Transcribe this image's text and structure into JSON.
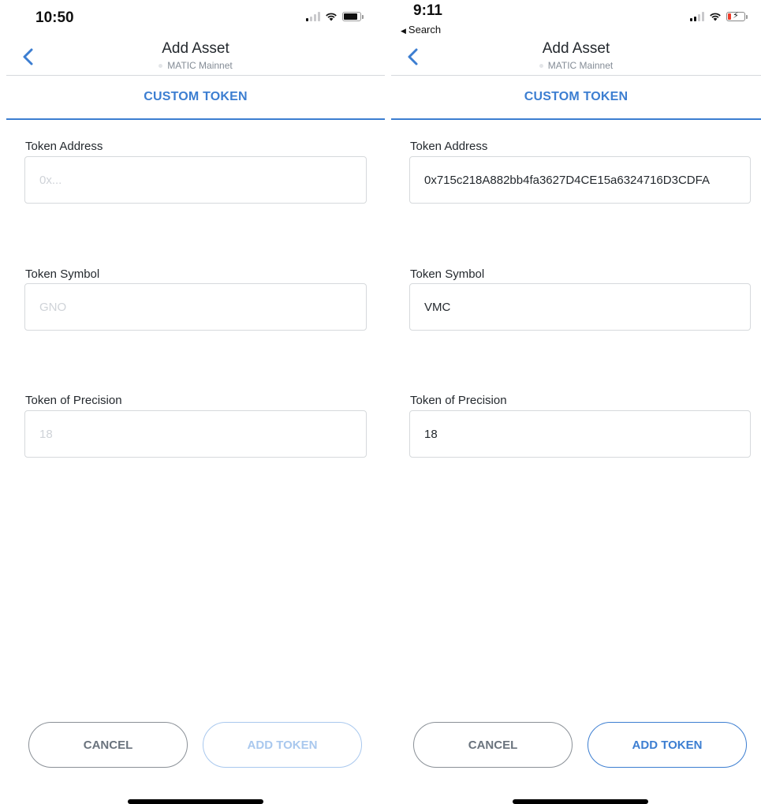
{
  "left": {
    "status": {
      "time": "10:50"
    },
    "header": {
      "title": "Add Asset",
      "network": "MATIC Mainnet"
    },
    "tab_label": "CUSTOM TOKEN",
    "fields": {
      "address": {
        "label": "Token Address",
        "value": "",
        "placeholder": "0x..."
      },
      "symbol": {
        "label": "Token Symbol",
        "value": "",
        "placeholder": "GNO"
      },
      "precision": {
        "label": "Token of Precision",
        "value": "",
        "placeholder": "18"
      }
    },
    "buttons": {
      "cancel": "CANCEL",
      "add": "ADD TOKEN",
      "add_enabled": false
    }
  },
  "right": {
    "status": {
      "time": "9:11",
      "back_app": "Search"
    },
    "header": {
      "title": "Add Asset",
      "network": "MATIC Mainnet"
    },
    "tab_label": "CUSTOM TOKEN",
    "fields": {
      "address": {
        "label": "Token Address",
        "value": "0x715c218A882bb4fa3627D4CE15a6324716D3CDFA",
        "placeholder": "0x..."
      },
      "symbol": {
        "label": "Token Symbol",
        "value": "VMC",
        "placeholder": "GNO"
      },
      "precision": {
        "label": "Token of Precision",
        "value": "18",
        "placeholder": "18"
      }
    },
    "buttons": {
      "cancel": "CANCEL",
      "add": "ADD TOKEN",
      "add_enabled": true
    }
  },
  "colors": {
    "accent": "#3c7ed1",
    "accent_disabled": "#a9c8ee",
    "text": "#24292e",
    "muted": "#848c96",
    "border": "#d6d9dc"
  },
  "icons": {
    "back": "chevron-left-icon",
    "signal": "cellular-signal-icon",
    "wifi": "wifi-icon",
    "battery": "battery-icon"
  }
}
